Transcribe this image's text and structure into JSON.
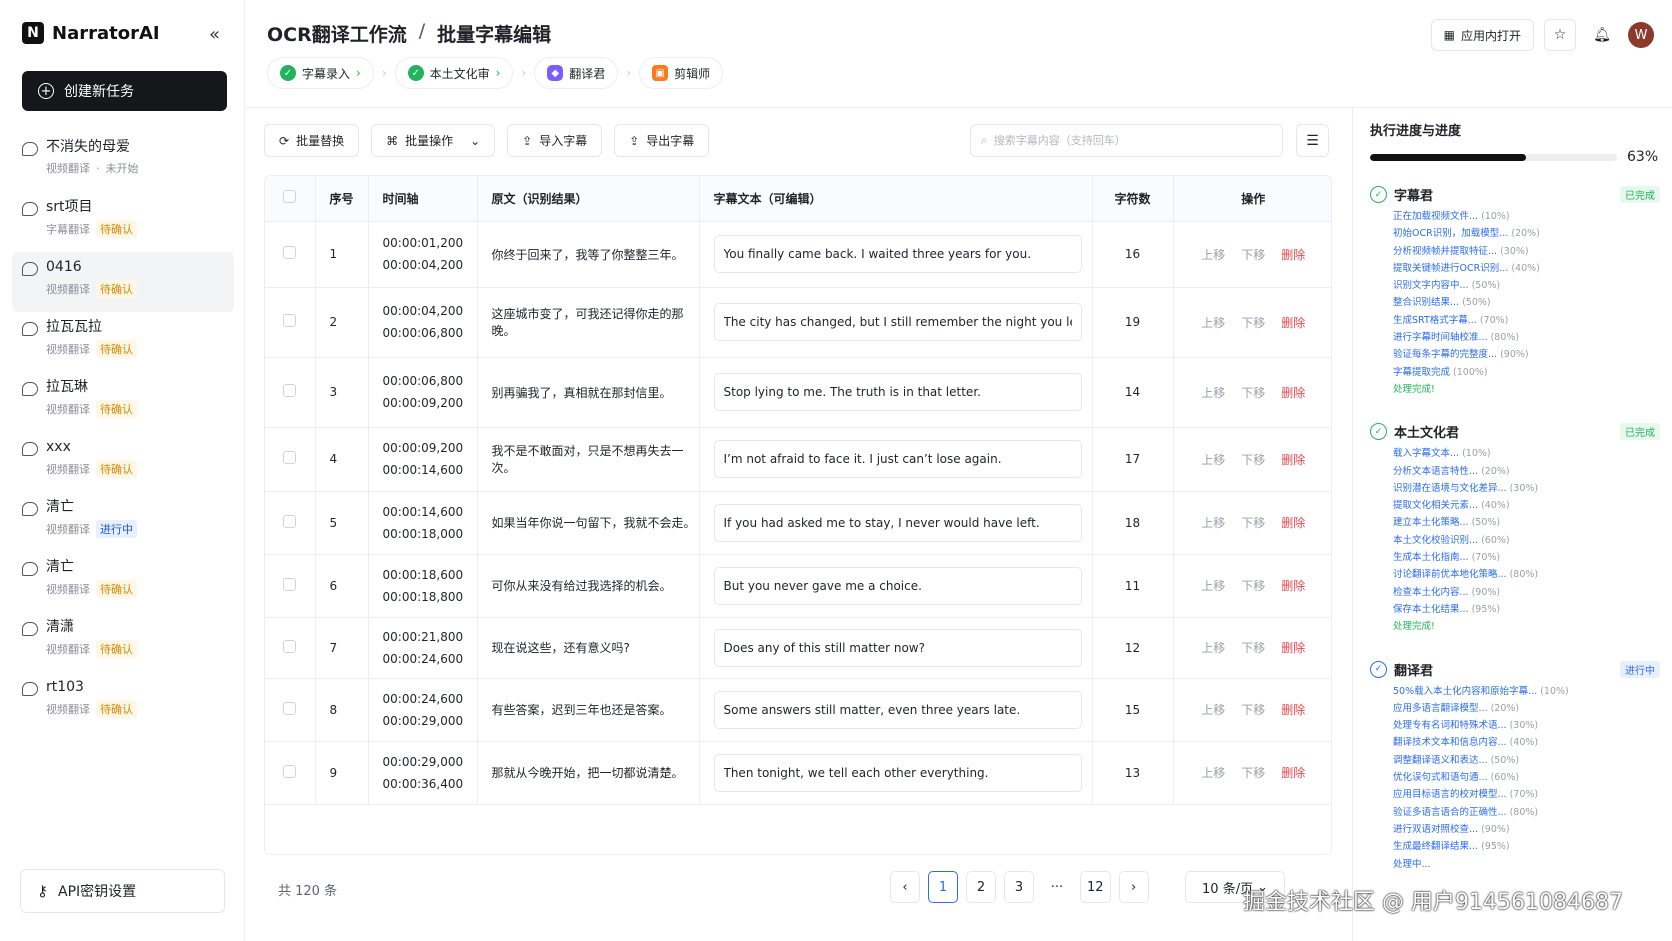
{
  "brand": {
    "name": "NarratorAI",
    "logo": "N"
  },
  "sidebar": {
    "new_task": "创建新任务",
    "tasks": [
      {
        "title": "不消失的母爱",
        "type": "视频翻译",
        "status": "未开始",
        "badge": ""
      },
      {
        "title": "srt项目",
        "type": "字幕翻译",
        "status": "",
        "badge": "待确认"
      },
      {
        "title": "0416",
        "type": "视频翻译",
        "status": "",
        "badge": "待确认"
      },
      {
        "title": "拉瓦瓦拉",
        "type": "视频翻译",
        "status": "",
        "badge": "待确认"
      },
      {
        "title": "拉瓦琳",
        "type": "视频翻译",
        "status": "",
        "badge": "待确认"
      },
      {
        "title": "xxx",
        "type": "视频翻译",
        "status": "",
        "badge": "待确认"
      },
      {
        "title": "清亡",
        "type": "视频翻译",
        "status": "",
        "badge": "进行中"
      },
      {
        "title": "清亡",
        "type": "视频翻译",
        "status": "",
        "badge": "待确认"
      },
      {
        "title": "清潇",
        "type": "视频翻译",
        "status": "",
        "badge": "待确认"
      },
      {
        "title": "rt103",
        "type": "视频翻译",
        "status": "",
        "badge": "待确认"
      }
    ],
    "api": "API密钥设置"
  },
  "header": {
    "crumb1": "OCR翻译工作流",
    "sep": "/",
    "crumb2": "批量字幕编辑",
    "open_app": "应用内打开",
    "avatar": "W",
    "steps": [
      "字幕录入",
      "本土文化审",
      "翻译君",
      "剪辑师"
    ]
  },
  "toolbar": {
    "replace": "批量替换",
    "batch": "批量操作",
    "import": "导入字幕",
    "export": "导出字幕",
    "search_placeholder": "搜索字幕内容（支持回车）"
  },
  "table": {
    "headers": [
      "序号",
      "时间轴",
      "原文（识别结果）",
      "字幕文本（可编辑）",
      "字符数",
      "操作"
    ],
    "ops": {
      "up": "上移",
      "down": "下移",
      "del": "删除"
    },
    "rows": [
      {
        "no": "1",
        "start": "00:00:01,200",
        "end": "00:00:04,200",
        "src": "你终于回来了，我等了你整整三年。",
        "text": "You finally came back. I waited three years for you.",
        "chars": "16"
      },
      {
        "no": "2",
        "start": "00:00:04,200",
        "end": "00:00:06,800",
        "src": "这座城市变了，可我还记得你走的那晚。",
        "text": "The city has changed, but I still remember the night you left.",
        "chars": "19"
      },
      {
        "no": "3",
        "start": "00:00:06,800",
        "end": "00:00:09,200",
        "src": "别再骗我了，真相就在那封信里。",
        "text": "Stop lying to me. The truth is in that letter.",
        "chars": "14"
      },
      {
        "no": "4",
        "start": "00:00:09,200",
        "end": "00:00:14,600",
        "src": "我不是不敢面对，只是不想再失去一次。",
        "text": "I’m not afraid to face it. I just can’t lose again.",
        "chars": "17"
      },
      {
        "no": "5",
        "start": "00:00:14,600",
        "end": "00:00:18,000",
        "src": "如果当年你说一句留下，我就不会走。",
        "text": "If you had asked me to stay, I never would have left.",
        "chars": "18"
      },
      {
        "no": "6",
        "start": "00:00:18,600",
        "end": "00:00:18,800",
        "src": "可你从来没有给过我选择的机会。",
        "text": "But you never gave me a choice.",
        "chars": "11"
      },
      {
        "no": "7",
        "start": "00:00:21,800",
        "end": "00:00:24,600",
        "src": "现在说这些，还有意义吗?",
        "text": "Does any of this still matter now?",
        "chars": "12"
      },
      {
        "no": "8",
        "start": "00:00:24,600",
        "end": "00:00:29,000",
        "src": "有些答案，迟到三年也还是答案。",
        "text": "Some answers still matter, even three years late.",
        "chars": "15"
      },
      {
        "no": "9",
        "start": "00:00:29,000",
        "end": "00:00:36,400",
        "src": "那就从今晚开始，把一切都说清楚。",
        "text": "Then tonight, we tell each other everything.",
        "chars": "13"
      }
    ]
  },
  "pagination": {
    "total": "共 120 条",
    "pages": [
      "1",
      "2",
      "3",
      "···",
      "12"
    ],
    "current": "1",
    "per_page": "10 条/页"
  },
  "panel": {
    "title": "执行进度与进度",
    "progress_pct": 63,
    "progress_label": "63%",
    "agents": [
      {
        "name": "字幕君",
        "status": "已完成",
        "state": "done",
        "logs": [
          [
            "正在加载视频文件...",
            "(10%)"
          ],
          [
            "初始OCR识别，加载模型...",
            "(20%)"
          ],
          [
            "分析视频帧并提取特征...",
            "(30%)"
          ],
          [
            "提取关键帧进行OCR识别...",
            "(40%)"
          ],
          [
            "识别文字内容中...",
            "(50%)"
          ],
          [
            "整合识别结果...",
            "(50%)"
          ],
          [
            "生成SRT格式字幕...",
            "(70%)"
          ],
          [
            "进行字幕时间轴校准...",
            "(80%)"
          ],
          [
            "验证每条字幕的完整度...",
            "(90%)"
          ],
          [
            "字幕提取完成",
            "(100%)"
          ]
        ],
        "final": "处理完成!"
      },
      {
        "name": "本土文化君",
        "status": "已完成",
        "state": "done",
        "logs": [
          [
            "载入字幕文本...",
            "(10%)"
          ],
          [
            "分析文本语言特性...",
            "(20%)"
          ],
          [
            "识别潜在语境与文化差异...",
            "(30%)"
          ],
          [
            "提取文化相关元素...",
            "(40%)"
          ],
          [
            "建立本土化策略...",
            "(50%)"
          ],
          [
            "本土文化校验识别...",
            "(60%)"
          ],
          [
            "生成本土化指南...",
            "(70%)"
          ],
          [
            "讨论翻译前优本地化策略...",
            "(80%)"
          ],
          [
            "检查本土化内容...",
            "(90%)"
          ],
          [
            "保存本土化结果...",
            "(95%)"
          ]
        ],
        "final": "处理完成!"
      },
      {
        "name": "翻译君",
        "status": "进行中",
        "state": "run",
        "logs": [
          [
            "50%载入本土化内容和原始字幕...",
            "(10%)"
          ],
          [
            "应用多语言翻译模型...",
            "(20%)"
          ],
          [
            "处理专有名词和特殊术语...",
            "(30%)"
          ],
          [
            "翻译技术文本和信息内容...",
            "(40%)"
          ],
          [
            "调整翻译语义和表达...",
            "(50%)"
          ],
          [
            "优化误句式和语句通...",
            "(60%)"
          ],
          [
            "应用目标语言的校对模型...",
            "(70%)"
          ],
          [
            "验证多语言语合的正确性...",
            "(80%)"
          ],
          [
            "进行双语对照校查...",
            "(90%)"
          ],
          [
            "生成最终翻译结果...",
            "(95%)"
          ]
        ],
        "final": "处理中..."
      }
    ]
  },
  "watermark": "掘金技术社区 @ 用户914561084687"
}
